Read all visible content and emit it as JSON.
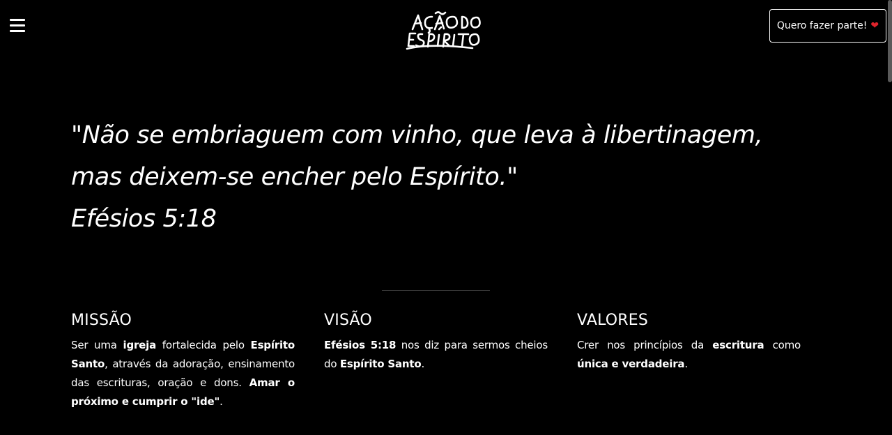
{
  "header": {
    "logo_text_line1": "AÇÃO DO",
    "logo_text_line2": "ESPÍRITO",
    "cta_label": "Quero fazer parte!",
    "cta_icon": "heart-icon",
    "menu_icon": "hamburger-menu-icon",
    "accent_color": "#e0242c"
  },
  "quote": {
    "line1": "\"Não se embriaguem com vinho, que leva à libertinagem,",
    "line2": "mas deixem-se encher pelo Espírito.\"",
    "reference": "Efésios 5:18"
  },
  "columns": [
    {
      "title": "MISSÃO",
      "segments": [
        {
          "text": "Ser uma ",
          "bold": false
        },
        {
          "text": "igreja",
          "bold": true
        },
        {
          "text": " fortalecida pelo ",
          "bold": false
        },
        {
          "text": "Espírito Santo",
          "bold": true
        },
        {
          "text": ", através da adoração, ensinamento das escrituras, oração e dons. ",
          "bold": false
        },
        {
          "text": "Amar o próximo e cumprir o \"ide\"",
          "bold": true
        },
        {
          "text": ".",
          "bold": false
        }
      ]
    },
    {
      "title": "VISÃO",
      "segments": [
        {
          "text": "Efésios 5:18",
          "bold": true
        },
        {
          "text": " nos diz para sermos cheios do ",
          "bold": false
        },
        {
          "text": "Espírito Santo",
          "bold": true
        },
        {
          "text": ".",
          "bold": false
        }
      ]
    },
    {
      "title": "VALORES",
      "segments": [
        {
          "text": "Crer nos princípios da ",
          "bold": false
        },
        {
          "text": "escritura",
          "bold": true
        },
        {
          "text": " como ",
          "bold": false
        },
        {
          "text": "única e verdadeira",
          "bold": true
        },
        {
          "text": ".",
          "bold": false
        }
      ]
    }
  ]
}
